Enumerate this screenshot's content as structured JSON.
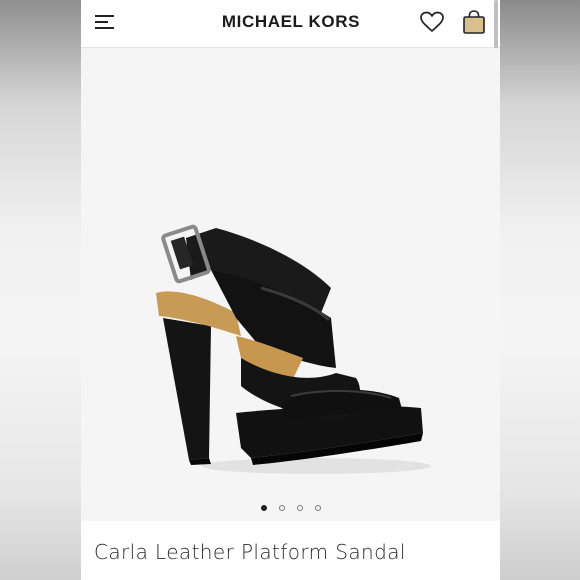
{
  "header": {
    "brand": "MICHAEL KORS",
    "menu_icon": "hamburger-menu-icon",
    "wishlist_icon": "heart-icon",
    "bag_icon": "shopping-bag-icon"
  },
  "product": {
    "name": "Carla Leather Platform Sandal",
    "image": "black-leather-platform-sandal"
  },
  "gallery": {
    "total_images": 4,
    "active_index": 0
  },
  "colors": {
    "text": "#1a1a1a",
    "bag_icon_fill": "#d9c08f",
    "gallery_bg": "#f5f5f5"
  }
}
